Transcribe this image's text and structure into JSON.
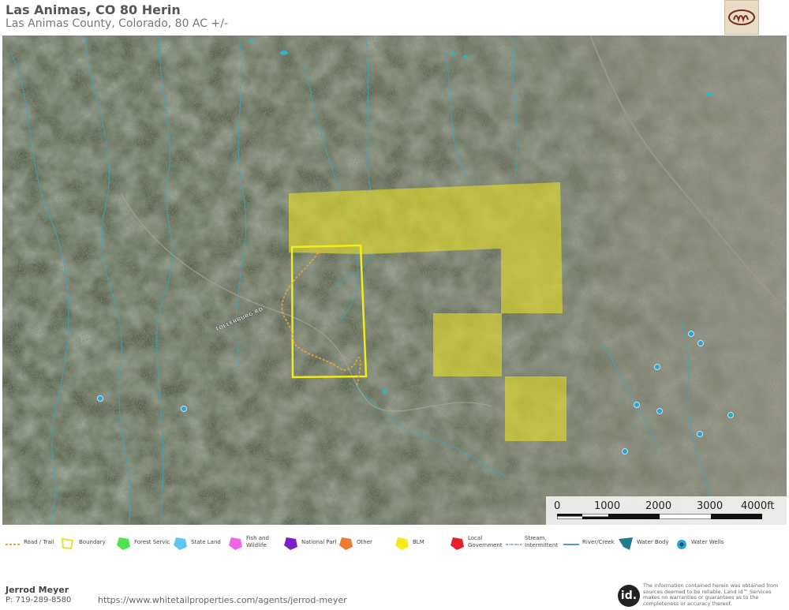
{
  "header": {
    "title": "Las Animas, CO 80 Herin",
    "subtitle": "Las Animas County, Colorado, 80 AC +/-"
  },
  "map": {
    "road_label": "TOLLERBURG RD",
    "scale": {
      "labels": [
        "0",
        "1000",
        "2000",
        "3000",
        "4000ft"
      ]
    }
  },
  "legend": {
    "items": [
      {
        "label": "Road / Trail",
        "icon": "road-trail-icon",
        "color": "#e8a23a"
      },
      {
        "label": "Boundary",
        "icon": "boundary-icon",
        "color": "#e2e23a"
      },
      {
        "label": "Forest Servic",
        "icon": "forest-service-icon",
        "color": "#4de34d"
      },
      {
        "label": "State Land",
        "icon": "state-land-icon",
        "color": "#5cc8f0"
      },
      {
        "label": "Fish and Wildlife",
        "icon": "fish-wildlife-icon",
        "color": "#f064e6"
      },
      {
        "label": "National Parl",
        "icon": "national-park-icon",
        "color": "#7a1fc4"
      },
      {
        "label": "Other",
        "icon": "other-icon",
        "color": "#f07a30"
      },
      {
        "label": "BLM",
        "icon": "blm-icon",
        "color": "#f5ea1e"
      },
      {
        "label": "Local Government",
        "icon": "local-government-icon",
        "color": "#e8202a"
      },
      {
        "label": "Stream, Intermittent",
        "icon": "stream-intermittent-icon",
        "color": "#4aa5c4"
      },
      {
        "label": "River/Creek",
        "icon": "river-creek-icon",
        "color": "#3a8fb0"
      },
      {
        "label": "Water Body",
        "icon": "water-body-icon",
        "color": "#1f7a8c"
      },
      {
        "label": "Water Wells",
        "icon": "water-well-icon",
        "color": "#27a8d8"
      }
    ]
  },
  "footer": {
    "agent_name": "Jerrod Meyer",
    "phone": "P: 719-289-8580",
    "url": "https://www.whitetailproperties.com/agents/jerrod-meyer",
    "id_logo": "id.",
    "disclaimer": "The information contained herein was obtained from sources deemed to be reliable. Land id™ Services makes no warranties or guarantees as to the completeness or accuracy thereof."
  }
}
